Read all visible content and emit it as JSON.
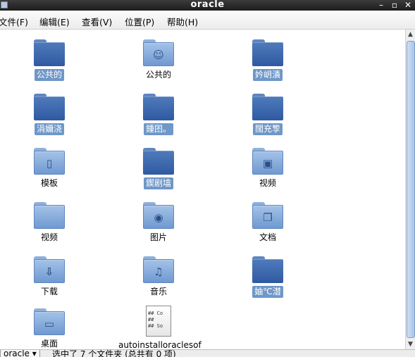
{
  "window": {
    "title": "oracle"
  },
  "menu": {
    "file": "文件(F)",
    "edit": "编辑(E)",
    "view": "查看(V)",
    "places": "位置(P)",
    "help": "帮助(H)"
  },
  "items": [
    {
      "label": "公共的",
      "selected": true,
      "icon": "folder-icon"
    },
    {
      "label": "公共的",
      "selected": false,
      "icon": "folder-user-icon"
    },
    {
      "label": "妗岄潰",
      "selected": true,
      "icon": "folder-icon"
    },
    {
      "label": "涓嬭浇",
      "selected": true,
      "icon": "folder-icon"
    },
    {
      "label": "鍾囨。",
      "selected": true,
      "icon": "folder-icon"
    },
    {
      "label": "闊充箰",
      "selected": true,
      "icon": "folder-icon"
    },
    {
      "label": "模板",
      "selected": false,
      "icon": "folder-template-icon"
    },
    {
      "label": "鍥剧墖",
      "selected": true,
      "icon": "folder-icon"
    },
    {
      "label": "视频",
      "selected": false,
      "icon": "folder-video-icon"
    },
    {
      "label": "视频",
      "selected": false,
      "icon": "folder-icon"
    },
    {
      "label": "图片",
      "selected": false,
      "icon": "folder-pictures-icon"
    },
    {
      "label": "文档",
      "selected": false,
      "icon": "folder-documents-icon"
    },
    {
      "label": "下载",
      "selected": false,
      "icon": "folder-download-icon"
    },
    {
      "label": "音乐",
      "selected": false,
      "icon": "folder-music-icon"
    },
    {
      "label": "妯℃澘",
      "selected": true,
      "icon": "folder-icon"
    },
    {
      "label": "桌面",
      "selected": false,
      "icon": "folder-desktop-icon"
    },
    {
      "label": "autoinstalloraclesof",
      "selected": false,
      "icon": "text-file-icon"
    }
  ],
  "file_preview": {
    "line1": "## Co",
    "line2": "##",
    "line3": "## So"
  },
  "status": {
    "location": "oracle",
    "text": "选中了 7 个文件夹 (总共有 0 项)"
  }
}
